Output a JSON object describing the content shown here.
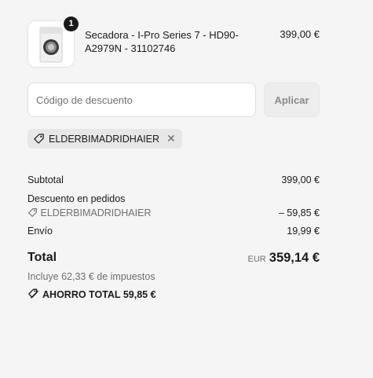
{
  "product": {
    "name": "Secadora - I-Pro Series 7 - HD90-A2979N - 31102746",
    "price": "399,00 €",
    "quantity": "1",
    "image_icon": "dryer-product-image"
  },
  "discount": {
    "placeholder": "Código de descuento",
    "apply_label": "Aplicar",
    "applied_code": "ELDERBIMADRIDHAIER"
  },
  "summary": {
    "subtotal_label": "Subtotal",
    "subtotal_value": "399,00 €",
    "order_discount_label": "Descuento en pedidos",
    "order_discount_code": "ELDERBIMADRIDHAIER",
    "order_discount_value": "– 59,85 €",
    "shipping_label": "Envío",
    "shipping_value": "19,99 €",
    "total_label": "Total",
    "total_currency": "EUR",
    "total_value": "359,14 €",
    "tax_note": "Incluye 62,33 € de impuestos",
    "savings_label": "AHORRO TOTAL",
    "savings_value": "59,85 €"
  },
  "colors": {
    "background": "#f5f5f5",
    "text": "#1a1a1a",
    "muted": "#707070",
    "chip": "#e7e7e7"
  }
}
